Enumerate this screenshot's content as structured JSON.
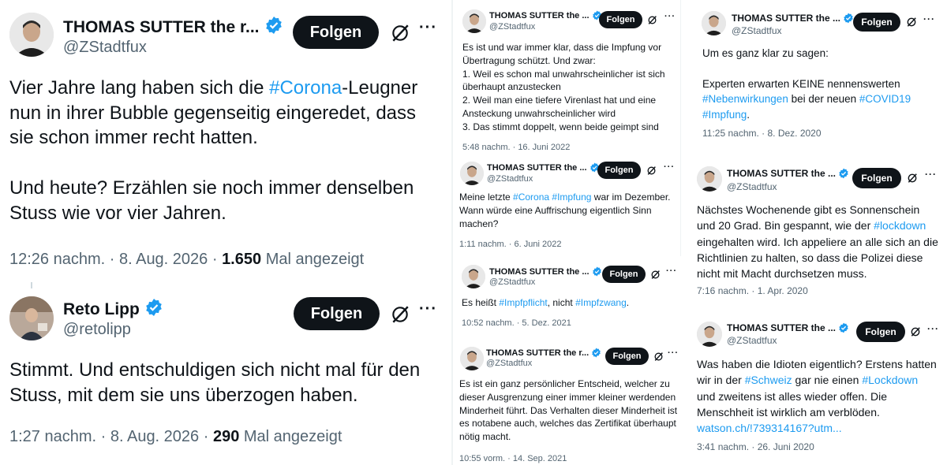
{
  "follow_label": "Folgen",
  "views_suffix": "Mal angezeigt",
  "colors": {
    "hashtag": "#1d9bf0",
    "verified": "#1d9bf0",
    "follow_bg": "#0f1419",
    "meta": "#536471"
  },
  "icons": [
    "verified-badge-icon",
    "grok-icon",
    "more-icon"
  ],
  "tweets": [
    {
      "name": "THOMAS SUTTER the r...",
      "handle": "@ZStadtfux",
      "text_parts": [
        [
          "Vier Jahre lang haben sich die ",
          "#Corona",
          "-Leugner nun in ihrer Bubble gegenseitig eingeredet, dass sie schon immer recht hatten."
        ],
        [
          "Und heute? Erzählen sie noch immer denselben Stuss wie vor vier Jahren."
        ]
      ],
      "time": "12:26 nachm. · 8. Aug. 2026 · ",
      "views": "1.650"
    },
    {
      "name": "Reto Lipp",
      "handle": "@retolipp",
      "text": "Stimmt. Und entschuldigen sich nicht mal für den Stuss, mit dem sie uns überzogen haben.",
      "time": "1:27 nachm. · 8. Aug. 2026 · ",
      "views": "290"
    },
    {
      "name": "THOMAS SUTTER the ...",
      "handle": "@ZStadtfux",
      "lines": [
        "Es ist und war immer klar, dass die Impfung vor Übertragung schützt. Und zwar:",
        "1.  Weil es schon mal unwahrscheinlicher ist sich überhaupt anzustecken",
        "2. Weil man eine tiefere Virenlast hat und eine Ansteckung unwahrscheinlicher wird",
        "3. Das stimmt doppelt, wenn beide geimpt sind"
      ],
      "time": "5:48 nachm. · 16. Juni 2022"
    },
    {
      "name": "THOMAS SUTTER the ...",
      "handle": "@ZStadtfux",
      "parts": [
        "Meine letzte ",
        "#Corona",
        " ",
        "#Impfung",
        " war im Dezember. Wann würde eine Auffrischung eigentlich Sinn machen?"
      ],
      "time": "1:11 nachm. · 6. Juni 2022"
    },
    {
      "name": "THOMAS SUTTER the ...",
      "handle": "@ZStadtfux",
      "parts": [
        "Es heißt ",
        "#Impfpflicht",
        ", nicht ",
        "#Impfzwang",
        "."
      ],
      "time": "10:52 nachm. · 5. Dez. 2021"
    },
    {
      "name": "THOMAS SUTTER the r...",
      "handle": "@ZStadtfux",
      "text": "Es ist ein ganz persönlicher Entscheid, welcher zu dieser Ausgrenzung einer immer kleiner werdenden Minderheit führt. Das Verhalten dieser Minderheit ist es notabene auch, welches das Zertifikat überhaupt nötig macht.",
      "time": "10:55 vorm. · 14. Sep. 2021"
    },
    {
      "name": "THOMAS SUTTER the ...",
      "handle": "@ZStadtfux",
      "line1": "Um es ganz klar zu sagen:",
      "parts": [
        "Experten erwarten KEINE nennenswerten ",
        "#Nebenwirkungen",
        " bei der neuen ",
        "#COVID19",
        " ",
        "#Impfung",
        "."
      ],
      "time": "11:25 nachm. · 8. Dez. 2020"
    },
    {
      "name": "THOMAS SUTTER the ...",
      "handle": "@ZStadtfux",
      "parts": [
        "Nächstes Wochenende gibt es Sonnenschein und 20 Grad. Bin gespannt, wie der ",
        "#lockdown",
        " eingehalten wird. Ich appeliere an alle sich an die Richtlinien zu halten, so dass die Polizei diese nicht mit Macht durchsetzen muss."
      ],
      "time": "7:16 nachm. · 1. Apr. 2020"
    },
    {
      "name": "THOMAS SUTTER the ...",
      "handle": "@ZStadtfux",
      "parts": [
        "Was haben die Idioten eigentlich? Erstens hatten wir in der ",
        "#Schweiz",
        " gar nie einen ",
        "#Lockdown",
        " und zweitens ist alles wieder offen. Die Menschheit ist wirklich am verblöden.",
        "watson.ch/!739314167?utm..."
      ],
      "time": "3:41 nachm. · 26. Juni 2020"
    }
  ]
}
